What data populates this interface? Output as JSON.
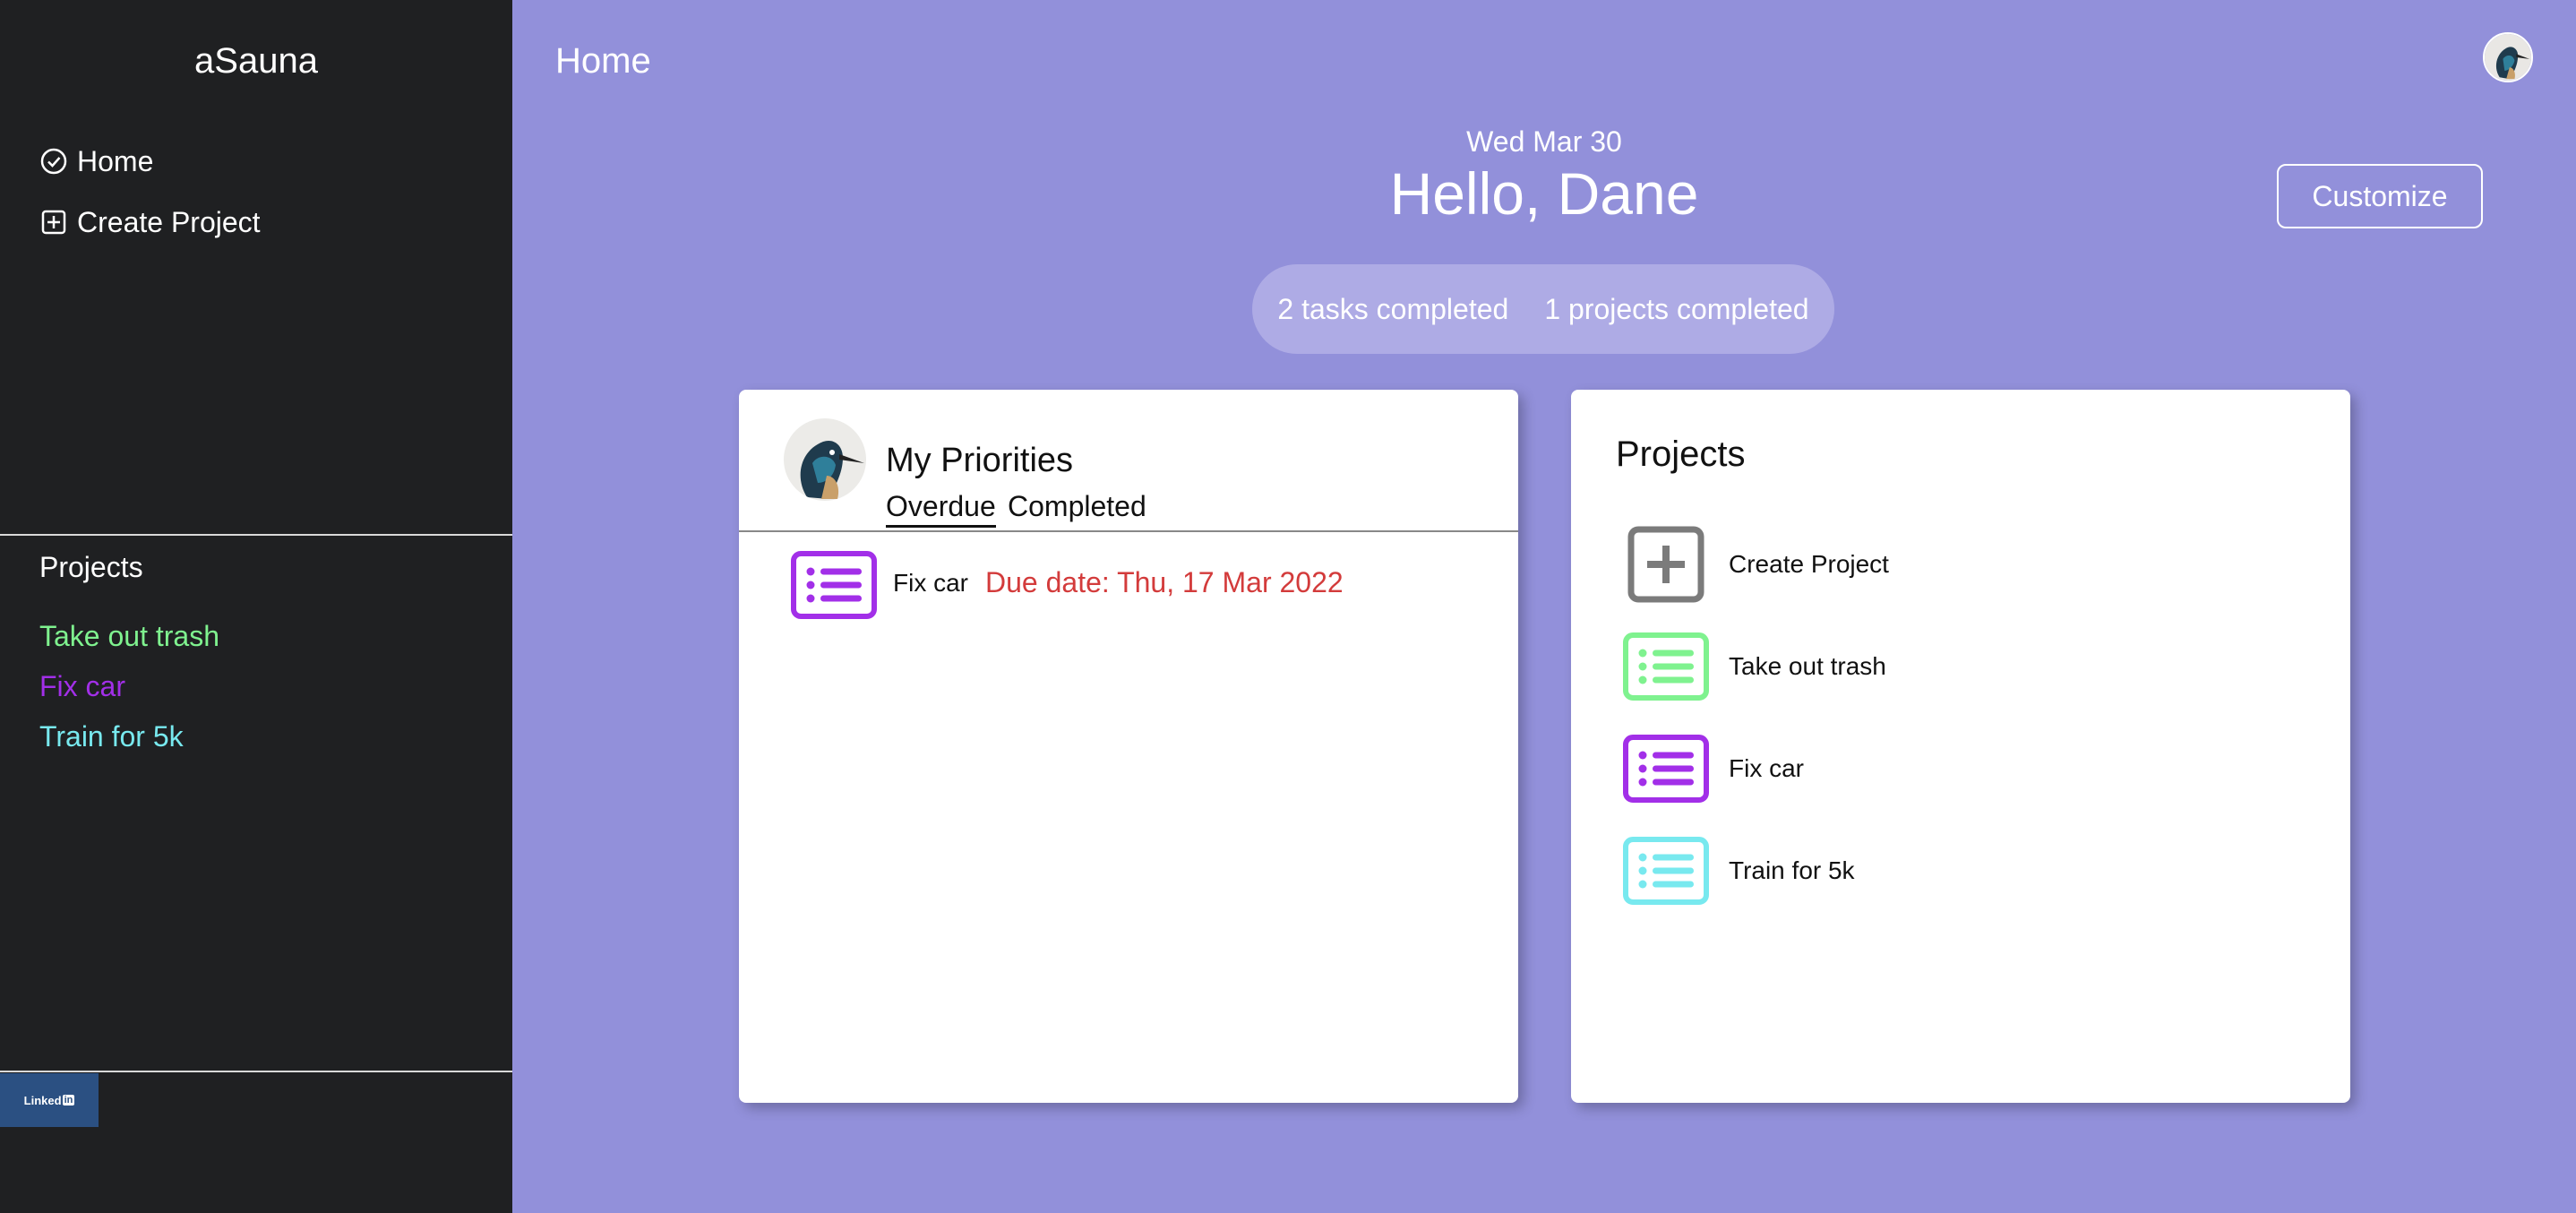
{
  "app": {
    "brand": "aSauna"
  },
  "sidebar": {
    "nav": [
      {
        "label": "Home",
        "icon": "check-circle-icon"
      },
      {
        "label": "Create Project",
        "icon": "plus-square-icon"
      }
    ],
    "projects_heading": "Projects",
    "projects": [
      {
        "label": "Take out trash",
        "color": "#7ff28f"
      },
      {
        "label": "Fix car",
        "color": "#a22fe8"
      },
      {
        "label": "Train for 5k",
        "color": "#78e9ef"
      }
    ],
    "linkedin": {
      "label": "Linked",
      "badge": "in"
    }
  },
  "header": {
    "title": "Home"
  },
  "greeting": {
    "date": "Wed Mar 30",
    "hello": "Hello, Dane"
  },
  "customize_label": "Customize",
  "stats": {
    "tasks": "2 tasks completed",
    "projects": "1 projects completed"
  },
  "priorities": {
    "title": "My Priorities",
    "tabs": [
      "Overdue",
      "Completed"
    ],
    "active_tab": "Overdue",
    "tasks": [
      {
        "name": "Fix car",
        "due": "Due date: Thu, 17 Mar 2022",
        "color": "#a22fe8"
      }
    ]
  },
  "projects_card": {
    "title": "Projects",
    "items": [
      {
        "label": "Create Project",
        "icon": "plus-square-icon",
        "color": "#7b7b7b"
      },
      {
        "label": "Take out trash",
        "icon": "list-icon",
        "color": "#7ff28f"
      },
      {
        "label": "Fix car",
        "icon": "list-icon",
        "color": "#a22fe8"
      },
      {
        "label": "Train for 5k",
        "icon": "list-icon",
        "color": "#78e9ef"
      }
    ]
  },
  "colors": {
    "background": "#9290da",
    "sidebar": "#1f2022",
    "due_date": "#d33b3b",
    "linkedin": "#2b5082"
  }
}
